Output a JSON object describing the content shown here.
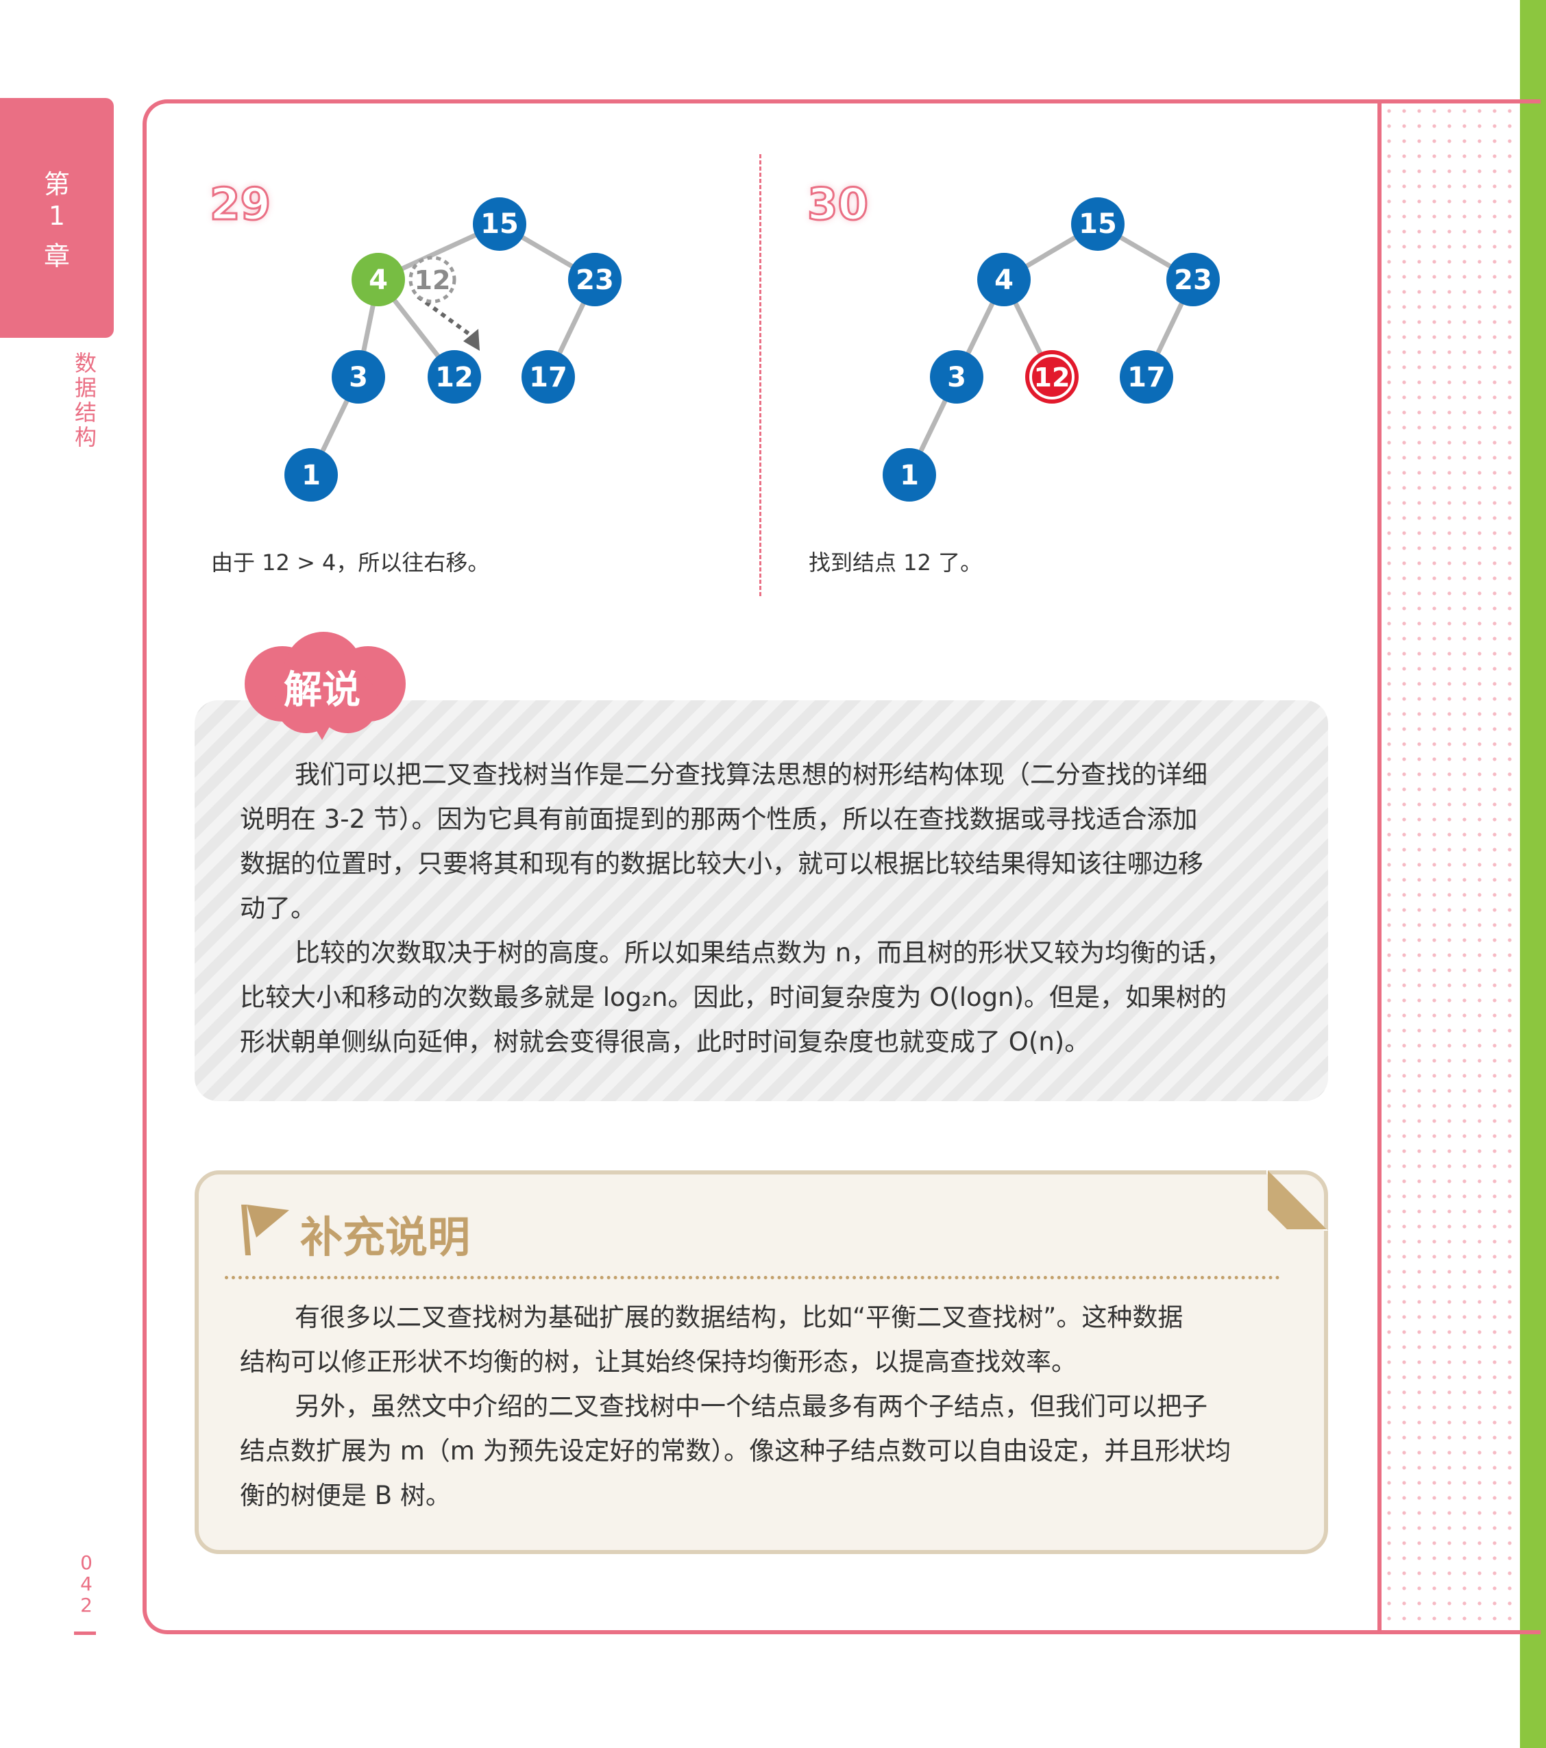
{
  "sidebar": {
    "chapter": [
      "第",
      "1",
      "章"
    ],
    "subject": [
      "数",
      "据",
      "结",
      "构"
    ],
    "page_number": [
      "0",
      "4",
      "2"
    ]
  },
  "steps": [
    {
      "number": "29",
      "caption": "由于 12 > 4，所以往右移。",
      "nodes": {
        "root": "15",
        "left": "4",
        "right": "23",
        "ll": "3",
        "lr": "12",
        "rl": "17",
        "lll": "1",
        "search": "12"
      }
    },
    {
      "number": "30",
      "caption": "找到结点 12 了。",
      "nodes": {
        "root": "15",
        "left": "4",
        "right": "23",
        "ll": "3",
        "lr": "12",
        "rl": "17",
        "lll": "1"
      }
    }
  ],
  "commentary": {
    "label": "解说",
    "p1_lines": [
      "我们可以把二叉查找树当作是二分查找算法思想的树形结构体现（二分查找的详细",
      "说明在 3-2 节）。因为它具有前面提到的那两个性质，所以在查找数据或寻找适合添加",
      "数据的位置时，只要将其和现有的数据比较大小，就可以根据比较结果得知该往哪边移",
      "动了。"
    ],
    "p2_lines": [
      "比较的次数取决于树的高度。所以如果结点数为 n，而且树的形状又较为均衡的话，",
      "比较大小和移动的次数最多就是 log₂n。因此，时间复杂度为 O(logn)。但是，如果树的",
      "形状朝单侧纵向延伸，树就会变得很高，此时时间复杂度也就变成了 O(n)。"
    ]
  },
  "supplement": {
    "title": "补充说明",
    "p1_lines": [
      "有很多以二叉查找树为基础扩展的数据结构，比如“平衡二叉查找树”。这种数据",
      "结构可以修正形状不均衡的树，让其始终保持均衡形态，以提高查找效率。"
    ],
    "p2_lines": [
      "另外，虽然文中介绍的二叉查找树中一个结点最多有两个子结点，但我们可以把子",
      "结点数扩展为 m（m 为预先设定好的常数）。像这种子结点数可以自由设定，并且形状均",
      "衡的树便是 B 树。"
    ]
  },
  "colors": {
    "accent_pink": "#ea6f84",
    "node_blue": "#0b6cb8",
    "node_green": "#77bd43",
    "node_found_red": "#e2192c",
    "supplement_gold": "#c2a06b",
    "side_green": "#8cc63f"
  }
}
